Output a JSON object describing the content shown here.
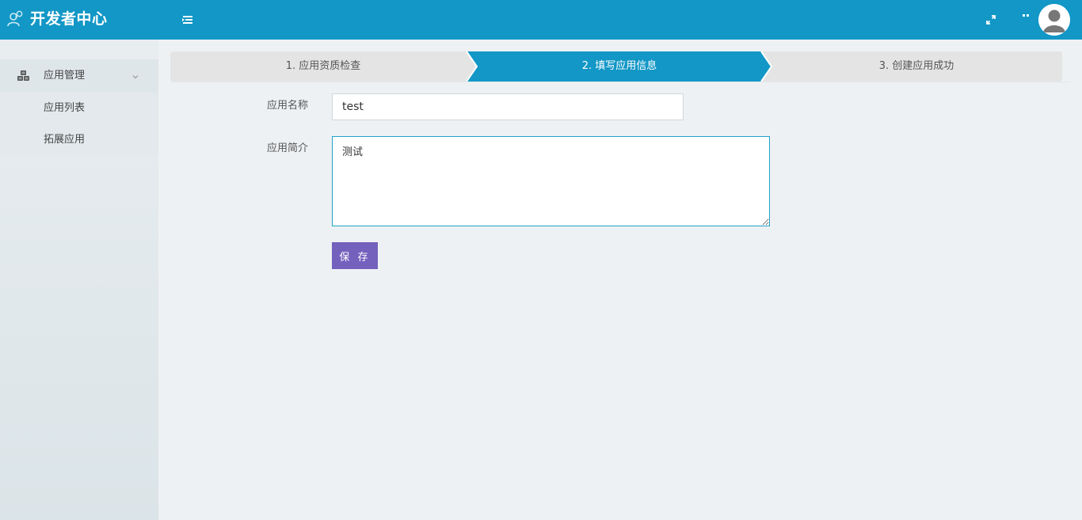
{
  "header": {
    "title": "开发者中心",
    "brand_color": "#1297c6",
    "icons": [
      "logo-icon",
      "menu-toggle-icon",
      "fullscreen-icon",
      "more-icon",
      "user-avatar-icon"
    ]
  },
  "sidebar": {
    "group": {
      "label": "应用管理",
      "icon": "cubes-icon",
      "expanded": true
    },
    "items": [
      {
        "label": "应用列表"
      },
      {
        "label": "拓展应用"
      }
    ]
  },
  "steps": {
    "items": [
      {
        "label": "1. 应用资质检查",
        "active": false
      },
      {
        "label": "2. 填写应用信息",
        "active": true
      },
      {
        "label": "3. 创建应用成功",
        "active": false
      }
    ],
    "active_color": "#1297c6",
    "inactive_color": "#e4e4e4"
  },
  "form": {
    "name_label": "应用名称",
    "name_value": "test",
    "desc_label": "应用简介",
    "desc_value": "测试",
    "save_label": "保 存",
    "save_color": "#7460bd"
  }
}
